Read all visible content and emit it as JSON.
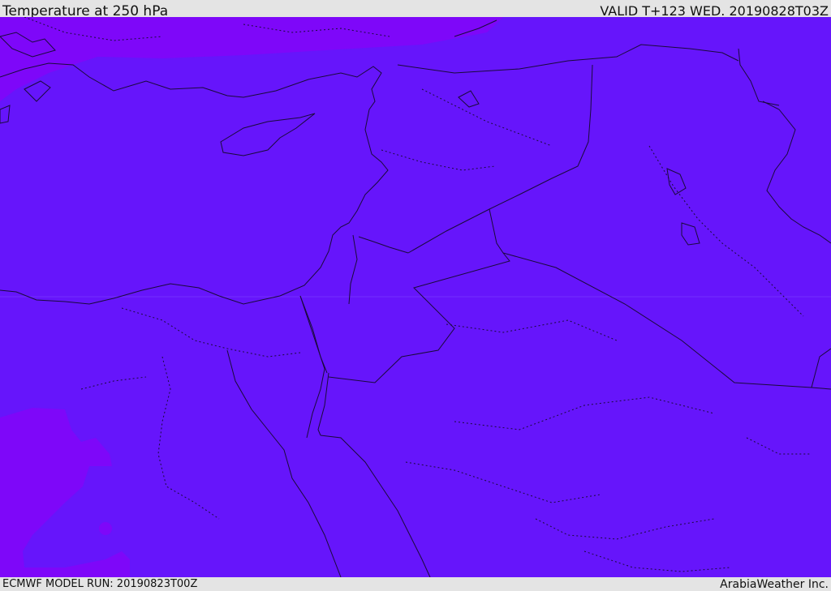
{
  "header": {
    "title": "Temperature at 250 hPa",
    "valid": "VALID T+123 WED. 20190828T03Z"
  },
  "footer": {
    "model_run": "ECMWF MODEL RUN: 20190823T00Z",
    "credit": "ArabiaWeather Inc."
  },
  "colors": {
    "field_main": "#6615fb",
    "field_warm": "#7e07f9",
    "coastline": "#1a0a3a",
    "bar_background": "#e4e4e4"
  }
}
